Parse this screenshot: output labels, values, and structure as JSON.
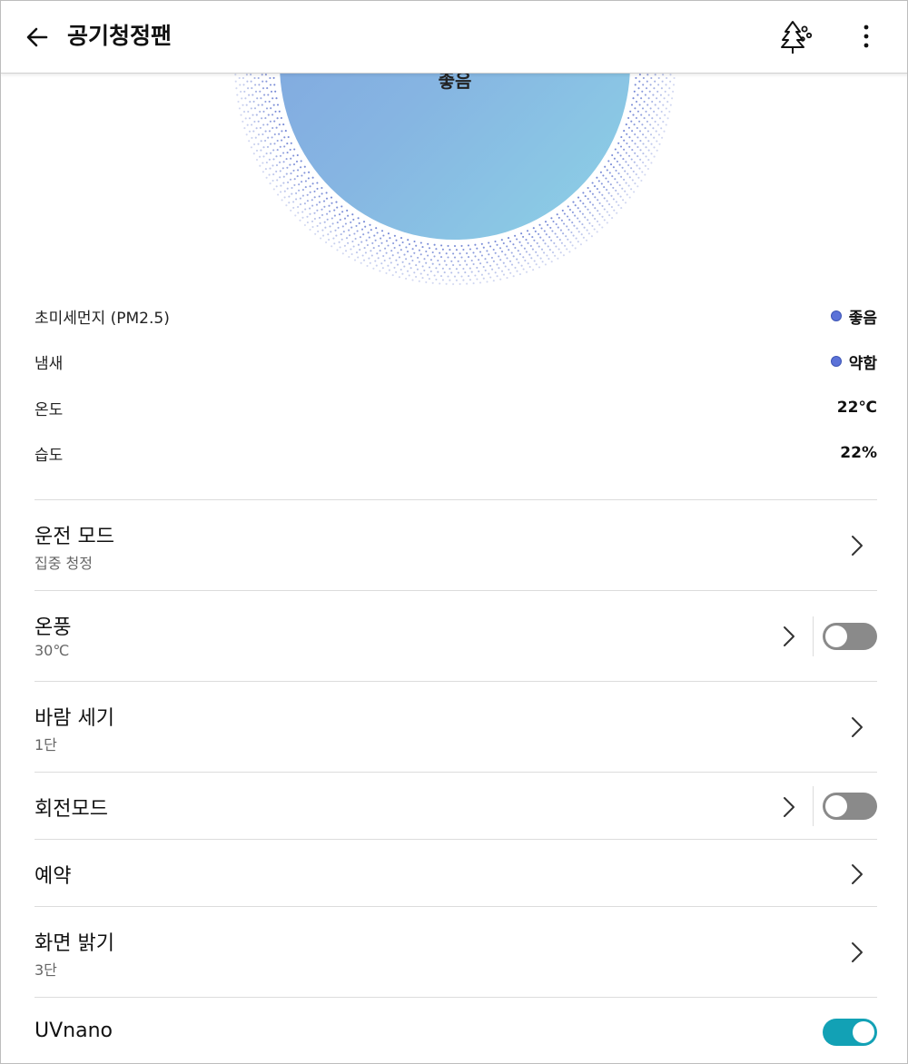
{
  "header": {
    "title": "공기청정팬",
    "back_icon": "arrow-left-icon",
    "tree_icon": "tree-icon",
    "more_icon": "more-vertical-icon"
  },
  "hero": {
    "status_label": "좋음",
    "circle_color_start": "#7FA3E0",
    "circle_color_end": "#86CBE0",
    "dot_color": "#4A63C8"
  },
  "stats": [
    {
      "label": "초미세먼지 (PM2.5)",
      "value": "좋음",
      "dot_color": "#5B72D8"
    },
    {
      "label": "냄새",
      "value": "약함",
      "dot_color": "#5B72D8"
    },
    {
      "label": "온도",
      "value": "22℃"
    },
    {
      "label": "습도",
      "value": "22%"
    }
  ],
  "settings": [
    {
      "title": "운전 모드",
      "subtitle": "집중 청정"
    },
    {
      "title": "온풍",
      "subtitle": "30℃",
      "toggle": false
    },
    {
      "title": "바람 세기",
      "subtitle": "1단"
    },
    {
      "title": "회전모드",
      "toggle": false
    },
    {
      "title": "예약"
    },
    {
      "title": "화면 밝기",
      "subtitle": "3단"
    },
    {
      "title": "UVnano",
      "toggle": true
    }
  ],
  "colors": {
    "toggle_on": "#12A1B5",
    "toggle_off": "#8A8A8A"
  }
}
